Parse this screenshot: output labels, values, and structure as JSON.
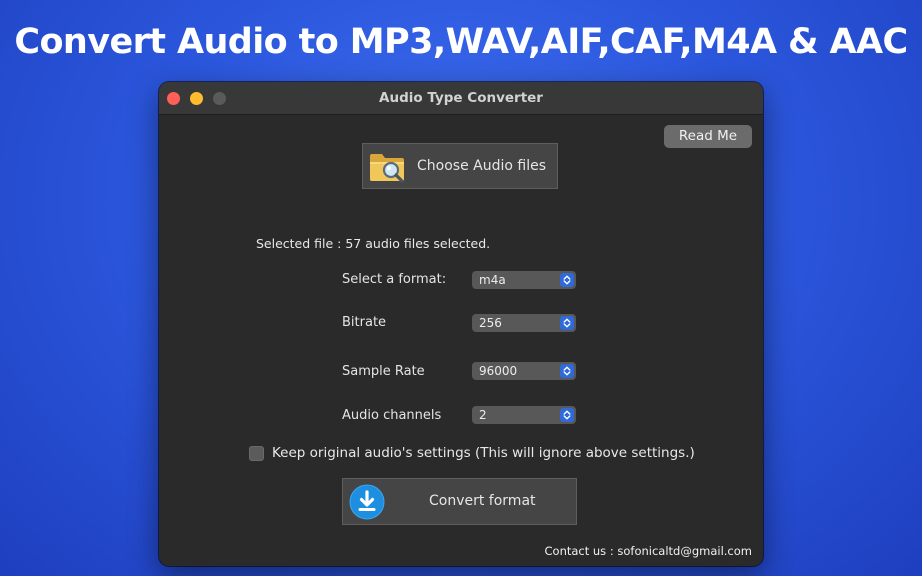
{
  "headline": "Convert Audio to MP3,WAV,AIF,CAF,M4A & AAC",
  "window": {
    "title": "Audio Type Converter"
  },
  "toolbar": {
    "read_me_label": "Read Me",
    "choose_label": "Choose Audio files",
    "choose_icon": "folder-search-icon"
  },
  "selection": {
    "status": "Selected file : 57 audio files selected."
  },
  "settings": {
    "format": {
      "label": "Select a format:",
      "value": "m4a"
    },
    "bitrate": {
      "label": "Bitrate",
      "value": "256"
    },
    "sample_rate": {
      "label": "Sample Rate",
      "value": "96000"
    },
    "channels": {
      "label": "Audio channels",
      "value": "2"
    }
  },
  "keep_original": {
    "label": "Keep original audio's settings (This will ignore above settings.)",
    "checked": false
  },
  "convert": {
    "label": "Convert format",
    "icon": "download-icon"
  },
  "footer": {
    "contact": "Contact us : sofonicaltd@gmail.com"
  },
  "colors": {
    "background": "#2c58de",
    "window": "#2a2a2a",
    "accent": "#2f6ad8",
    "close": "#fe5f57",
    "minimize": "#febc2e"
  }
}
